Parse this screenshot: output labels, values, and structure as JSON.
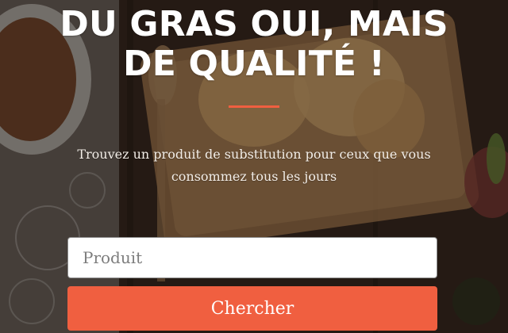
{
  "hero": {
    "title": "DU GRAS OUI, MAIS DE QUALITÉ !",
    "subtitle": "Trouvez un produit de substitution pour ceux que vous consommez tous les jours"
  },
  "search": {
    "placeholder": "Produit",
    "value": "",
    "button_label": "Chercher"
  },
  "colors": {
    "accent": "#f05f40",
    "overlay": "#000000"
  }
}
